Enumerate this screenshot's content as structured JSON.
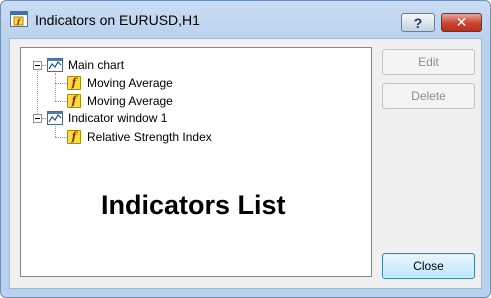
{
  "window": {
    "title": "Indicators on EURUSD,H1",
    "help_label": "?",
    "close_label": "✕"
  },
  "tree": {
    "groups": [
      {
        "label": "Main chart",
        "children": [
          "Moving Average",
          "Moving Average"
        ]
      },
      {
        "label": "Indicator window 1",
        "children": [
          "Relative Strength Index"
        ]
      }
    ],
    "indicator_icon_glyph": "f"
  },
  "overlay": {
    "caption": "Indicators List"
  },
  "buttons": {
    "edit": "Edit",
    "delete": "Delete",
    "close": "Close"
  },
  "icons": {
    "app": "indicators-window-icon",
    "chart": "chart-window-icon",
    "indicator": "indicator-function-icon"
  },
  "colors": {
    "title_gradient_top": "#c9dcf3",
    "close_button_red": "#c8432e",
    "indicator_icon_yellow": "#f8dc3c",
    "disabled_text": "#8d8d8d"
  }
}
